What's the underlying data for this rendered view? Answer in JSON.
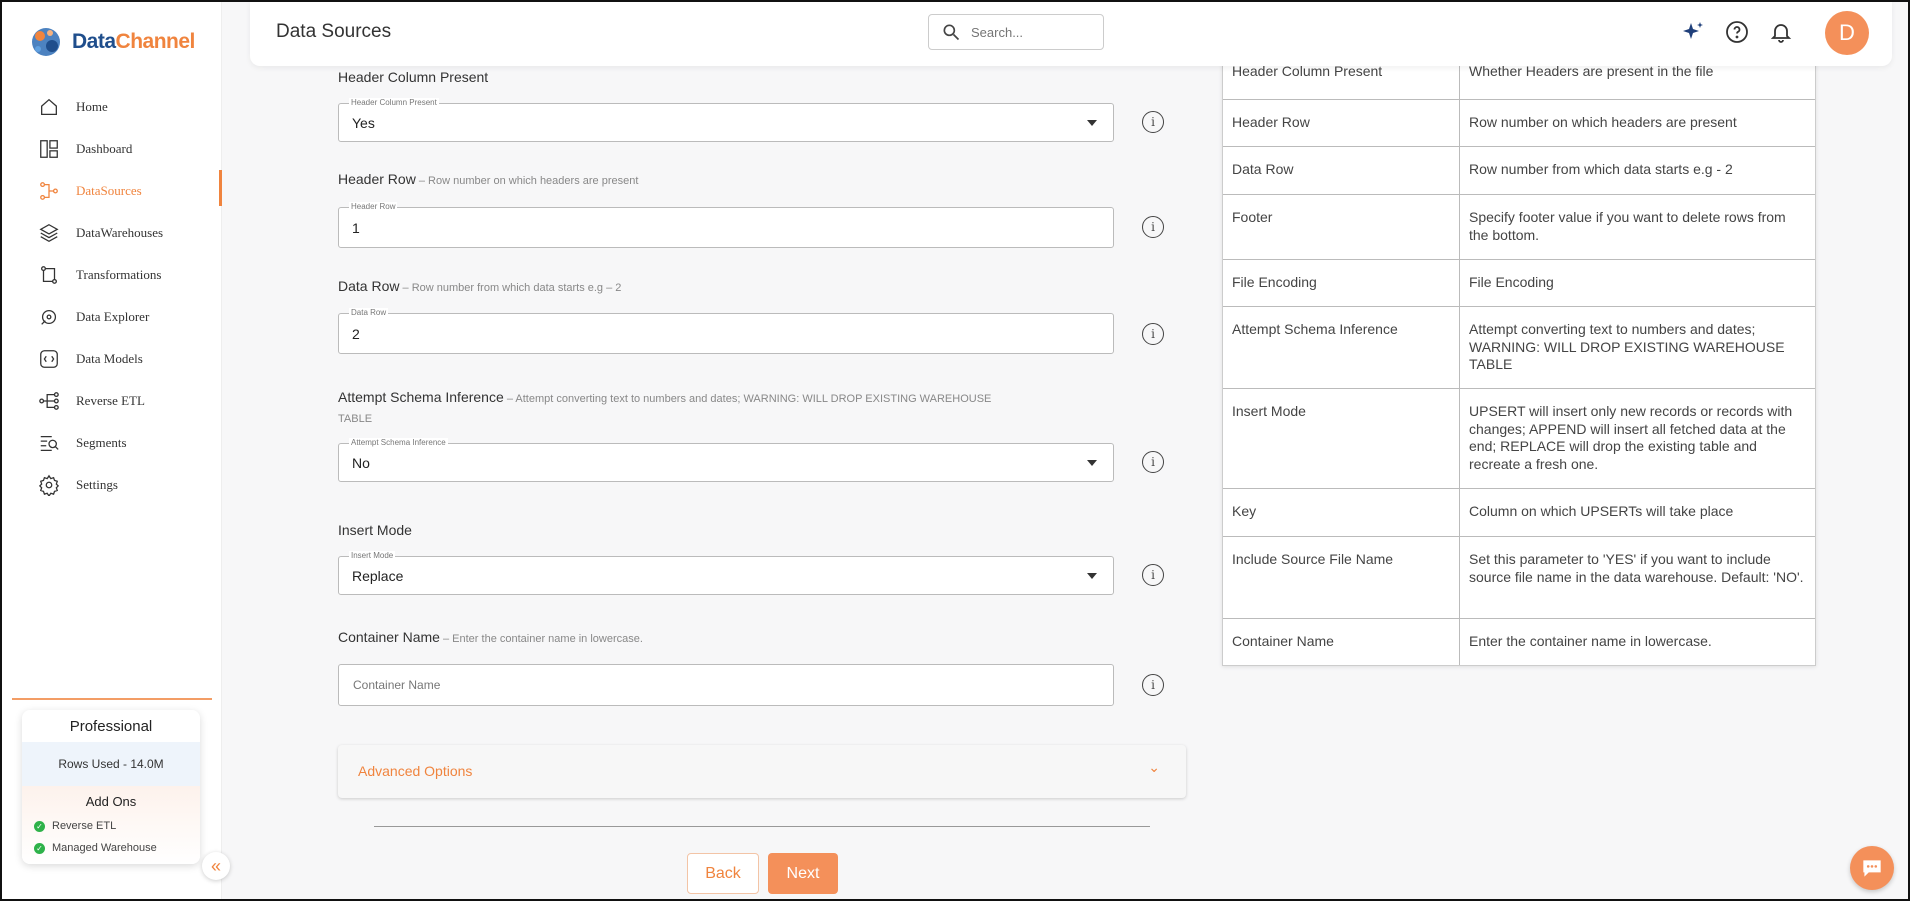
{
  "brand": {
    "name_a": "Data",
    "name_b": "Channel"
  },
  "header": {
    "title": "Data Sources",
    "search_placeholder": "Search..."
  },
  "user": {
    "initial": "D"
  },
  "sidebar": {
    "items": [
      {
        "label": "Home",
        "icon": "home-icon"
      },
      {
        "label": "Dashboard",
        "icon": "dashboard-icon"
      },
      {
        "label": "DataSources",
        "icon": "datasources-icon",
        "active": true
      },
      {
        "label": "DataWarehouses",
        "icon": "layers-icon"
      },
      {
        "label": "Transformations",
        "icon": "transform-icon"
      },
      {
        "label": "Data Explorer",
        "icon": "explorer-icon"
      },
      {
        "label": "Data Models",
        "icon": "models-icon"
      },
      {
        "label": "Reverse ETL",
        "icon": "reverse-etl-icon"
      },
      {
        "label": "Segments",
        "icon": "segments-icon"
      },
      {
        "label": "Settings",
        "icon": "gear-icon"
      }
    ],
    "plan": {
      "name": "Professional",
      "rows_used": "Rows Used - 14.0M",
      "addons_title": "Add Ons",
      "addons": [
        "Reverse ETL",
        "Managed Warehouse"
      ]
    }
  },
  "form": {
    "header_col": {
      "label": "Header Column Present",
      "legend": "Header Column Present",
      "value": "Yes"
    },
    "header_row": {
      "label": "Header Row",
      "hint": " – Row number on which headers are present",
      "legend": "Header Row",
      "value": "1"
    },
    "data_row": {
      "label": "Data Row",
      "hint": " – Row number from which data starts e.g – 2",
      "legend": "Data Row",
      "value": "2"
    },
    "schema": {
      "label": "Attempt Schema Inference",
      "hint": " – Attempt converting text to numbers and dates; WARNING: WILL DROP EXISTING WAREHOUSE",
      "hint2": "TABLE",
      "legend": "Attempt Schema Inference",
      "value": "No"
    },
    "insert_mode": {
      "label": "Insert Mode",
      "legend": "Insert Mode",
      "value": "Replace"
    },
    "container": {
      "label": "Container Name",
      "hint": " – Enter the container name in lowercase.",
      "placeholder": "Container Name"
    },
    "advanced": "Advanced Options",
    "back": "Back",
    "next": "Next"
  },
  "help": [
    {
      "k": "Header Column Present",
      "v": "Whether Headers are present in the file"
    },
    {
      "k": "Header Row",
      "v": "Row number on which headers are present"
    },
    {
      "k": "Data Row",
      "v": "Row number from which data starts e.g - 2"
    },
    {
      "k": "Footer",
      "v": "Specify footer value if you want to delete rows from the bottom."
    },
    {
      "k": "File Encoding",
      "v": "File Encoding"
    },
    {
      "k": "Attempt Schema Inference",
      "v": "Attempt converting text to numbers and dates; WARNING: WILL DROP EXISTING WAREHOUSE TABLE"
    },
    {
      "k": "Insert Mode",
      "v": "UPSERT will insert only new records or records with changes; APPEND will insert all fetched data at the end; REPLACE will drop the existing table and recreate a fresh one."
    },
    {
      "k": "Key",
      "v": "Column on which UPSERTs will take place"
    },
    {
      "k": "Include Source File Name",
      "v": "Set this parameter to 'YES' if you want to include source file name in the data warehouse. Default: 'NO'."
    },
    {
      "k": "Container Name",
      "v": "Enter the container name in lowercase."
    }
  ],
  "colors": {
    "accent": "#f0843e",
    "brand_blue": "#1f4e8c",
    "success": "#2eb24a"
  }
}
